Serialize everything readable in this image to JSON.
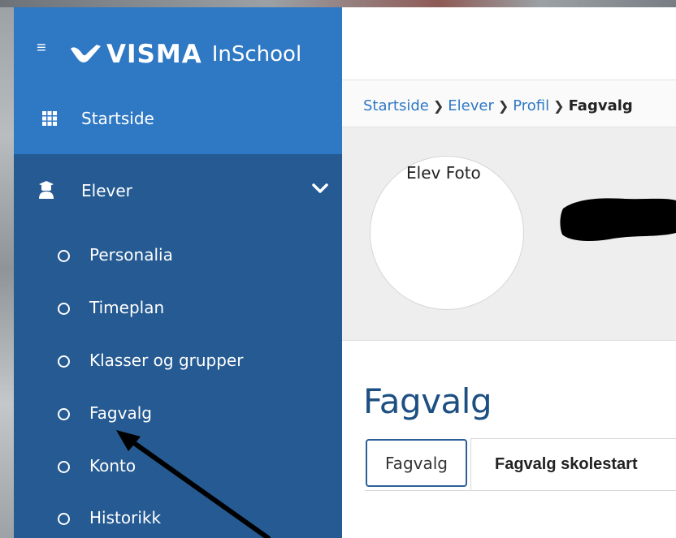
{
  "brand": {
    "name": "VISMA",
    "product": "InSchool"
  },
  "sidebar": {
    "home_label": "Startside",
    "section_label": "Elever",
    "items": [
      {
        "label": "Personalia"
      },
      {
        "label": "Timeplan"
      },
      {
        "label": "Klasser og grupper"
      },
      {
        "label": "Fagvalg"
      },
      {
        "label": "Konto"
      },
      {
        "label": "Historikk"
      }
    ]
  },
  "breadcrumb": {
    "items": [
      "Startside",
      "Elever",
      "Profil"
    ],
    "current": "Fagvalg"
  },
  "profile": {
    "photo_alt": "Elev Foto"
  },
  "page": {
    "title": "Fagvalg",
    "tabs": [
      {
        "label": "Fagvalg",
        "active": true
      },
      {
        "label": "Fagvalg skolestart",
        "active": false
      }
    ]
  },
  "colors": {
    "sidebar": "#255a92",
    "sidebar_header": "#2f78c4",
    "link": "#2f78c4",
    "title": "#1d4f82"
  }
}
